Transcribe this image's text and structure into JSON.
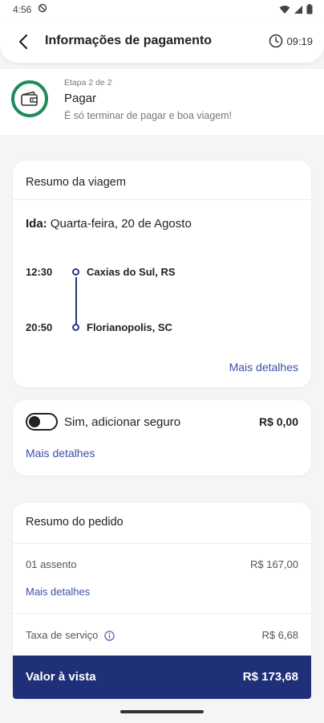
{
  "status_bar": {
    "time": "4:56"
  },
  "header": {
    "title": "Informações de pagamento",
    "timer": "09:19"
  },
  "step": {
    "label": "Etapa 2 de 2",
    "title": "Pagar",
    "subtitle": "É só terminar de pagar e boa viagem!"
  },
  "trip": {
    "title": "Resumo da viagem",
    "direction": "Ida:",
    "date": "Quarta-feira, 20 de Agosto",
    "departure_time": "12:30",
    "departure_city": "Caxias do Sul, RS",
    "arrival_time": "20:50",
    "arrival_city": "Florianopolis, SC",
    "more_label": "Mais detalhes"
  },
  "insurance": {
    "label": "Sim, adicionar seguro",
    "price": "R$ 0,00",
    "more_label": "Mais detalhes"
  },
  "order": {
    "title": "Resumo do pedido",
    "seat_label": "01 assento",
    "seat_value": "R$ 167,00",
    "more_label": "Mais detalhes",
    "fee_label": "Taxa de serviço",
    "fee_value": "R$ 6,68",
    "total_label": "Valor à vista",
    "total_value": "R$ 173,68"
  },
  "colors": {
    "accent_green": "#1f8a5b",
    "primary_navy": "#1f2f78",
    "link_blue": "#3d4fa8"
  }
}
